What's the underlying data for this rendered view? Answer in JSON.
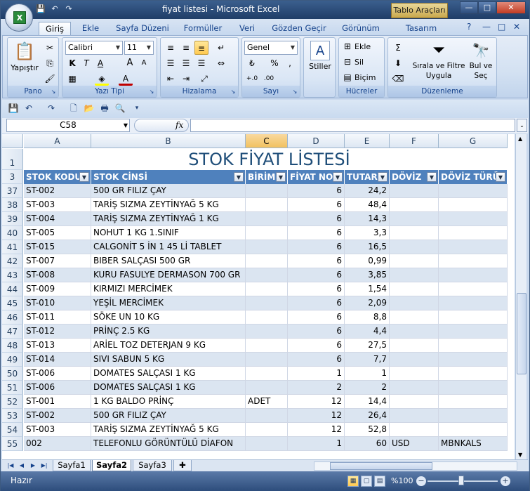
{
  "window": {
    "title": "fiyat listesi - Microsoft Excel",
    "context_tab": "Tablo Araçları",
    "min": "—",
    "max": "□",
    "close": "✕"
  },
  "tabs": [
    "Giriş",
    "Ekle",
    "Sayfa Düzeni",
    "Formüller",
    "Veri",
    "Gözden Geçir",
    "Görünüm",
    "Tasarım"
  ],
  "ribbon": {
    "pano": {
      "label": "Pano",
      "paste": "Yapıştır"
    },
    "font": {
      "label": "Yazı Tipi",
      "name": "Calibri",
      "size": "11",
      "bold": "K",
      "italic": "T",
      "underline": "A",
      "grow": "A",
      "shrink": "A"
    },
    "align": {
      "label": "Hizalama"
    },
    "number": {
      "label": "Sayı",
      "format": "Genel",
      "percent": "%",
      "comma": ","
    },
    "styles": {
      "label": "Stiller"
    },
    "cells": {
      "label": "Hücreler",
      "insert": "Ekle",
      "delete": "Sil",
      "format": "Biçim"
    },
    "edit": {
      "label": "Düzenleme",
      "sort1": "Sırala ve Filtre",
      "sort2": "Uygula",
      "find1": "Bul ve",
      "find2": "Seç"
    }
  },
  "namebox": "C58",
  "fx": "fx",
  "columns": [
    {
      "letter": "A",
      "header": "STOK KODU"
    },
    {
      "letter": "B",
      "header": "STOK CİNSİ"
    },
    {
      "letter": "C",
      "header": "BİRİM"
    },
    {
      "letter": "D",
      "header": "FİYAT NO"
    },
    {
      "letter": "E",
      "header": "TUTAR"
    },
    {
      "letter": "F",
      "header": "DÖVİZ"
    },
    {
      "letter": "G",
      "header": "DÖVİZ TÜRÜ"
    }
  ],
  "sheet_title": "STOK FİYAT LİSTESİ",
  "rows": [
    {
      "n": "37",
      "code": "ST-002",
      "name": "500 GR FILIZ ÇAY",
      "unit": "",
      "fno": "6",
      "amt": "24,2",
      "cur": "",
      "curtype": ""
    },
    {
      "n": "38",
      "code": "ST-003",
      "name": "TARİŞ SIZMA ZEYTİNYAĞ 5 KG",
      "unit": "",
      "fno": "6",
      "amt": "48,4",
      "cur": "",
      "curtype": ""
    },
    {
      "n": "39",
      "code": "ST-004",
      "name": "TARİŞ SIZMA ZEYTİNYAĞ 1 KG",
      "unit": "",
      "fno": "6",
      "amt": "14,3",
      "cur": "",
      "curtype": ""
    },
    {
      "n": "40",
      "code": "ST-005",
      "name": "NOHUT 1 KG 1.SINIF",
      "unit": "",
      "fno": "6",
      "amt": "3,3",
      "cur": "",
      "curtype": ""
    },
    {
      "n": "41",
      "code": "ST-015",
      "name": "CALGONİT 5 İN 1 45 Lİ TABLET",
      "unit": "",
      "fno": "6",
      "amt": "16,5",
      "cur": "",
      "curtype": ""
    },
    {
      "n": "42",
      "code": "ST-007",
      "name": "BIBER SALÇASI 500 GR",
      "unit": "",
      "fno": "6",
      "amt": "0,99",
      "cur": "",
      "curtype": ""
    },
    {
      "n": "43",
      "code": "ST-008",
      "name": "KURU FASULYE DERMASON 700 GR",
      "unit": "",
      "fno": "6",
      "amt": "3,85",
      "cur": "",
      "curtype": ""
    },
    {
      "n": "44",
      "code": "ST-009",
      "name": "KIRMIZI MERCİMEK",
      "unit": "",
      "fno": "6",
      "amt": "1,54",
      "cur": "",
      "curtype": ""
    },
    {
      "n": "45",
      "code": "ST-010",
      "name": "YEŞİL MERCİMEK",
      "unit": "",
      "fno": "6",
      "amt": "2,09",
      "cur": "",
      "curtype": ""
    },
    {
      "n": "46",
      "code": "ST-011",
      "name": "SÖKE UN 10 KG",
      "unit": "",
      "fno": "6",
      "amt": "8,8",
      "cur": "",
      "curtype": ""
    },
    {
      "n": "47",
      "code": "ST-012",
      "name": "PRİNÇ 2.5 KG",
      "unit": "",
      "fno": "6",
      "amt": "4,4",
      "cur": "",
      "curtype": ""
    },
    {
      "n": "48",
      "code": "ST-013",
      "name": "ARİEL TOZ DETERJAN 9 KG",
      "unit": "",
      "fno": "6",
      "amt": "27,5",
      "cur": "",
      "curtype": ""
    },
    {
      "n": "49",
      "code": "ST-014",
      "name": "SIVI SABUN 5 KG",
      "unit": "",
      "fno": "6",
      "amt": "7,7",
      "cur": "",
      "curtype": ""
    },
    {
      "n": "50",
      "code": "ST-006",
      "name": "DOMATES SALÇASI 1 KG",
      "unit": "",
      "fno": "1",
      "amt": "1",
      "cur": "",
      "curtype": ""
    },
    {
      "n": "51",
      "code": "ST-006",
      "name": "DOMATES SALÇASI 1 KG",
      "unit": "",
      "fno": "2",
      "amt": "2",
      "cur": "",
      "curtype": ""
    },
    {
      "n": "52",
      "code": "ST-001",
      "name": "1 KG BALDO PRİNÇ",
      "unit": "ADET",
      "fno": "12",
      "amt": "14,4",
      "cur": "",
      "curtype": ""
    },
    {
      "n": "53",
      "code": "ST-002",
      "name": "500 GR FILIZ ÇAY",
      "unit": "",
      "fno": "12",
      "amt": "26,4",
      "cur": "",
      "curtype": ""
    },
    {
      "n": "54",
      "code": "ST-003",
      "name": "TARİŞ SIZMA ZEYTİNYAĞ 5 KG",
      "unit": "",
      "fno": "12",
      "amt": "52,8",
      "cur": "",
      "curtype": ""
    },
    {
      "n": "55",
      "code": "002",
      "name": "TELEFONLU GÖRÜNTÜLÜ DİAFON",
      "unit": "",
      "fno": "1",
      "amt": "60",
      "cur": "USD",
      "curtype": "MBNKALS"
    }
  ],
  "sheets": [
    "Sayfa1",
    "Sayfa2",
    "Sayfa3"
  ],
  "status": {
    "ready": "Hazır",
    "zoom": "%100"
  }
}
